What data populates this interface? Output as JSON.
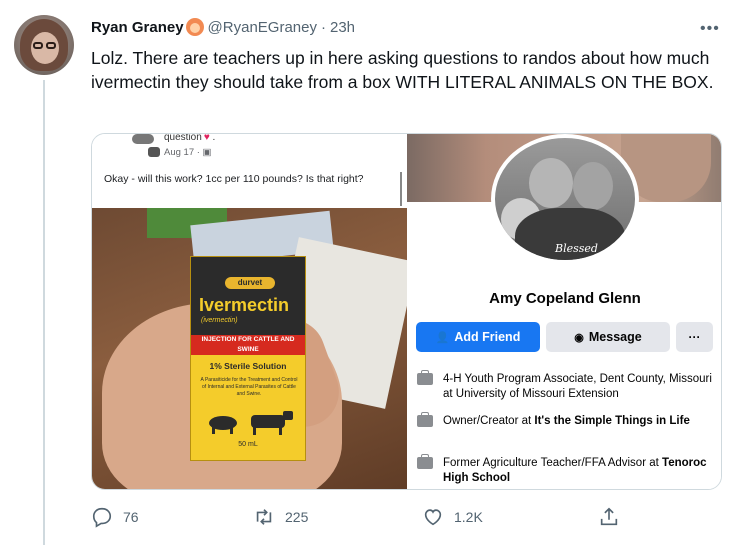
{
  "tweet": {
    "author_name": "Ryan Graney",
    "author_handle": "@RyanEGraney",
    "separator": "·",
    "time": "23h",
    "more_label": "•••",
    "text": "Lolz. There are teachers up in here asking questions to randos about how much ivermectin they should take from a box WITH LITERAL ANIMALS ON THE BOX."
  },
  "screenshot_left": {
    "snippet_question": "question",
    "snippet_date": "Aug 17 ·",
    "comment": "Okay - will this work? 1cc per 110 pounds? Is that right?",
    "box": {
      "brand": "durvet",
      "name": "Ivermectin",
      "subname": "(ivermectin)",
      "band": "INJECTION FOR CATTLE AND SWINE",
      "sterile": "1% Sterile Solution",
      "description": "A Parasiticide for the Treatment and Control of Internal and External Parasites of Cattle and Swine.",
      "volume": "50 mL"
    }
  },
  "screenshot_right": {
    "photo_caption": "Blessed",
    "profile_name": "Amy Copeland Glenn",
    "add_friend": "Add Friend",
    "message": "Message",
    "more": "···",
    "info": [
      {
        "text": "4-H Youth Program Associate, Dent County, Missouri at University of Missouri Extension"
      },
      {
        "prefix": "Owner/Creator at ",
        "bold": "It's the Simple Things in Life"
      },
      {
        "prefix": "Former Agriculture Teacher/FFA Advisor at ",
        "bold": "Tenoroc High School"
      }
    ]
  },
  "actions": {
    "replies": "76",
    "retweets": "225",
    "likes": "1.2K"
  },
  "icons": [
    "reply-icon",
    "retweet-icon",
    "like-icon",
    "share-icon",
    "more-icon",
    "briefcase-icon",
    "add-person-icon",
    "messenger-icon"
  ],
  "colors": {
    "text": "#0f1419",
    "secondary": "#536471",
    "fb_blue": "#1877f2",
    "fb_gray": "#e4e6eb",
    "border": "#cfd9de"
  }
}
